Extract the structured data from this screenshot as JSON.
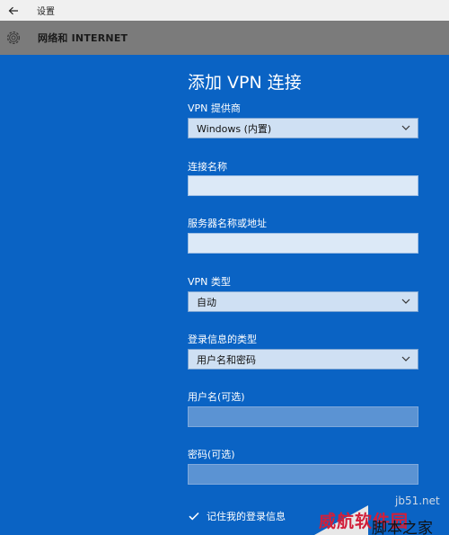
{
  "titlebar": {
    "title": "设置"
  },
  "header": {
    "section": "网络和 INTERNET"
  },
  "form": {
    "title": "添加 VPN 连接",
    "vpn_provider": {
      "label": "VPN 提供商",
      "value": "Windows (内置)"
    },
    "connection_name": {
      "label": "连接名称",
      "value": ""
    },
    "server_address": {
      "label": "服务器名称或地址",
      "value": ""
    },
    "vpn_type": {
      "label": "VPN 类型",
      "value": "自动"
    },
    "signin_type": {
      "label": "登录信息的类型",
      "value": "用户名和密码"
    },
    "username": {
      "label": "用户名(可选)",
      "value": ""
    },
    "password": {
      "label": "密码(可选)",
      "value": ""
    },
    "remember": {
      "label": "记住我的登录信息",
      "checked": true
    }
  },
  "watermark": {
    "red_text": "威航软件园",
    "black_text": "脚本之家",
    "faint_text": "jb51.net"
  },
  "colors": {
    "page_bg": "#0a63c4",
    "header_bg": "#7b7b7b",
    "titlebar_bg": "#f0f0f0",
    "select_bg": "#cfe0f3",
    "input_bg": "#dce9f7",
    "input_disabled_bg": "#5b93d3"
  },
  "icons": {
    "back": "arrow-left-icon",
    "settings": "gear-icon",
    "dropdown": "chevron-down-icon",
    "check": "checkmark-icon"
  }
}
